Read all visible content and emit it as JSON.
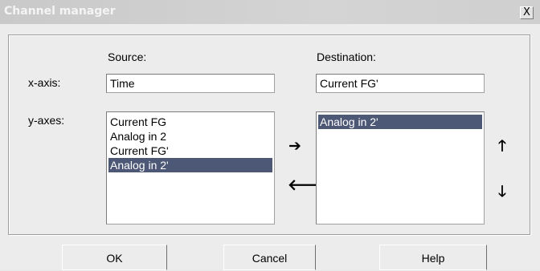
{
  "window": {
    "title": "Channel manager",
    "close_glyph": "X"
  },
  "labels": {
    "source": "Source:",
    "destination": "Destination:",
    "x_axis": "x-axis:",
    "y_axes": "y-axes:"
  },
  "source": {
    "x_axis_value": "Time",
    "y_axes": [
      {
        "label": "Current FG",
        "selected": false
      },
      {
        "label": "Analog in 2",
        "selected": false
      },
      {
        "label": "Current FG'",
        "selected": false
      },
      {
        "label": "Analog in 2'",
        "selected": true
      }
    ]
  },
  "destination": {
    "x_axis_value": "Current FG'",
    "y_axes": [
      {
        "label": "Analog in 2'",
        "selected": true
      }
    ]
  },
  "arrows": {
    "add": "➔",
    "remove": "🡐",
    "up": "🡑",
    "down": "🡓"
  },
  "buttons": {
    "ok": "OK",
    "cancel": "Cancel",
    "help": "Help"
  },
  "colors": {
    "selection": "#4d5876",
    "selection_text": "#ffffff"
  }
}
